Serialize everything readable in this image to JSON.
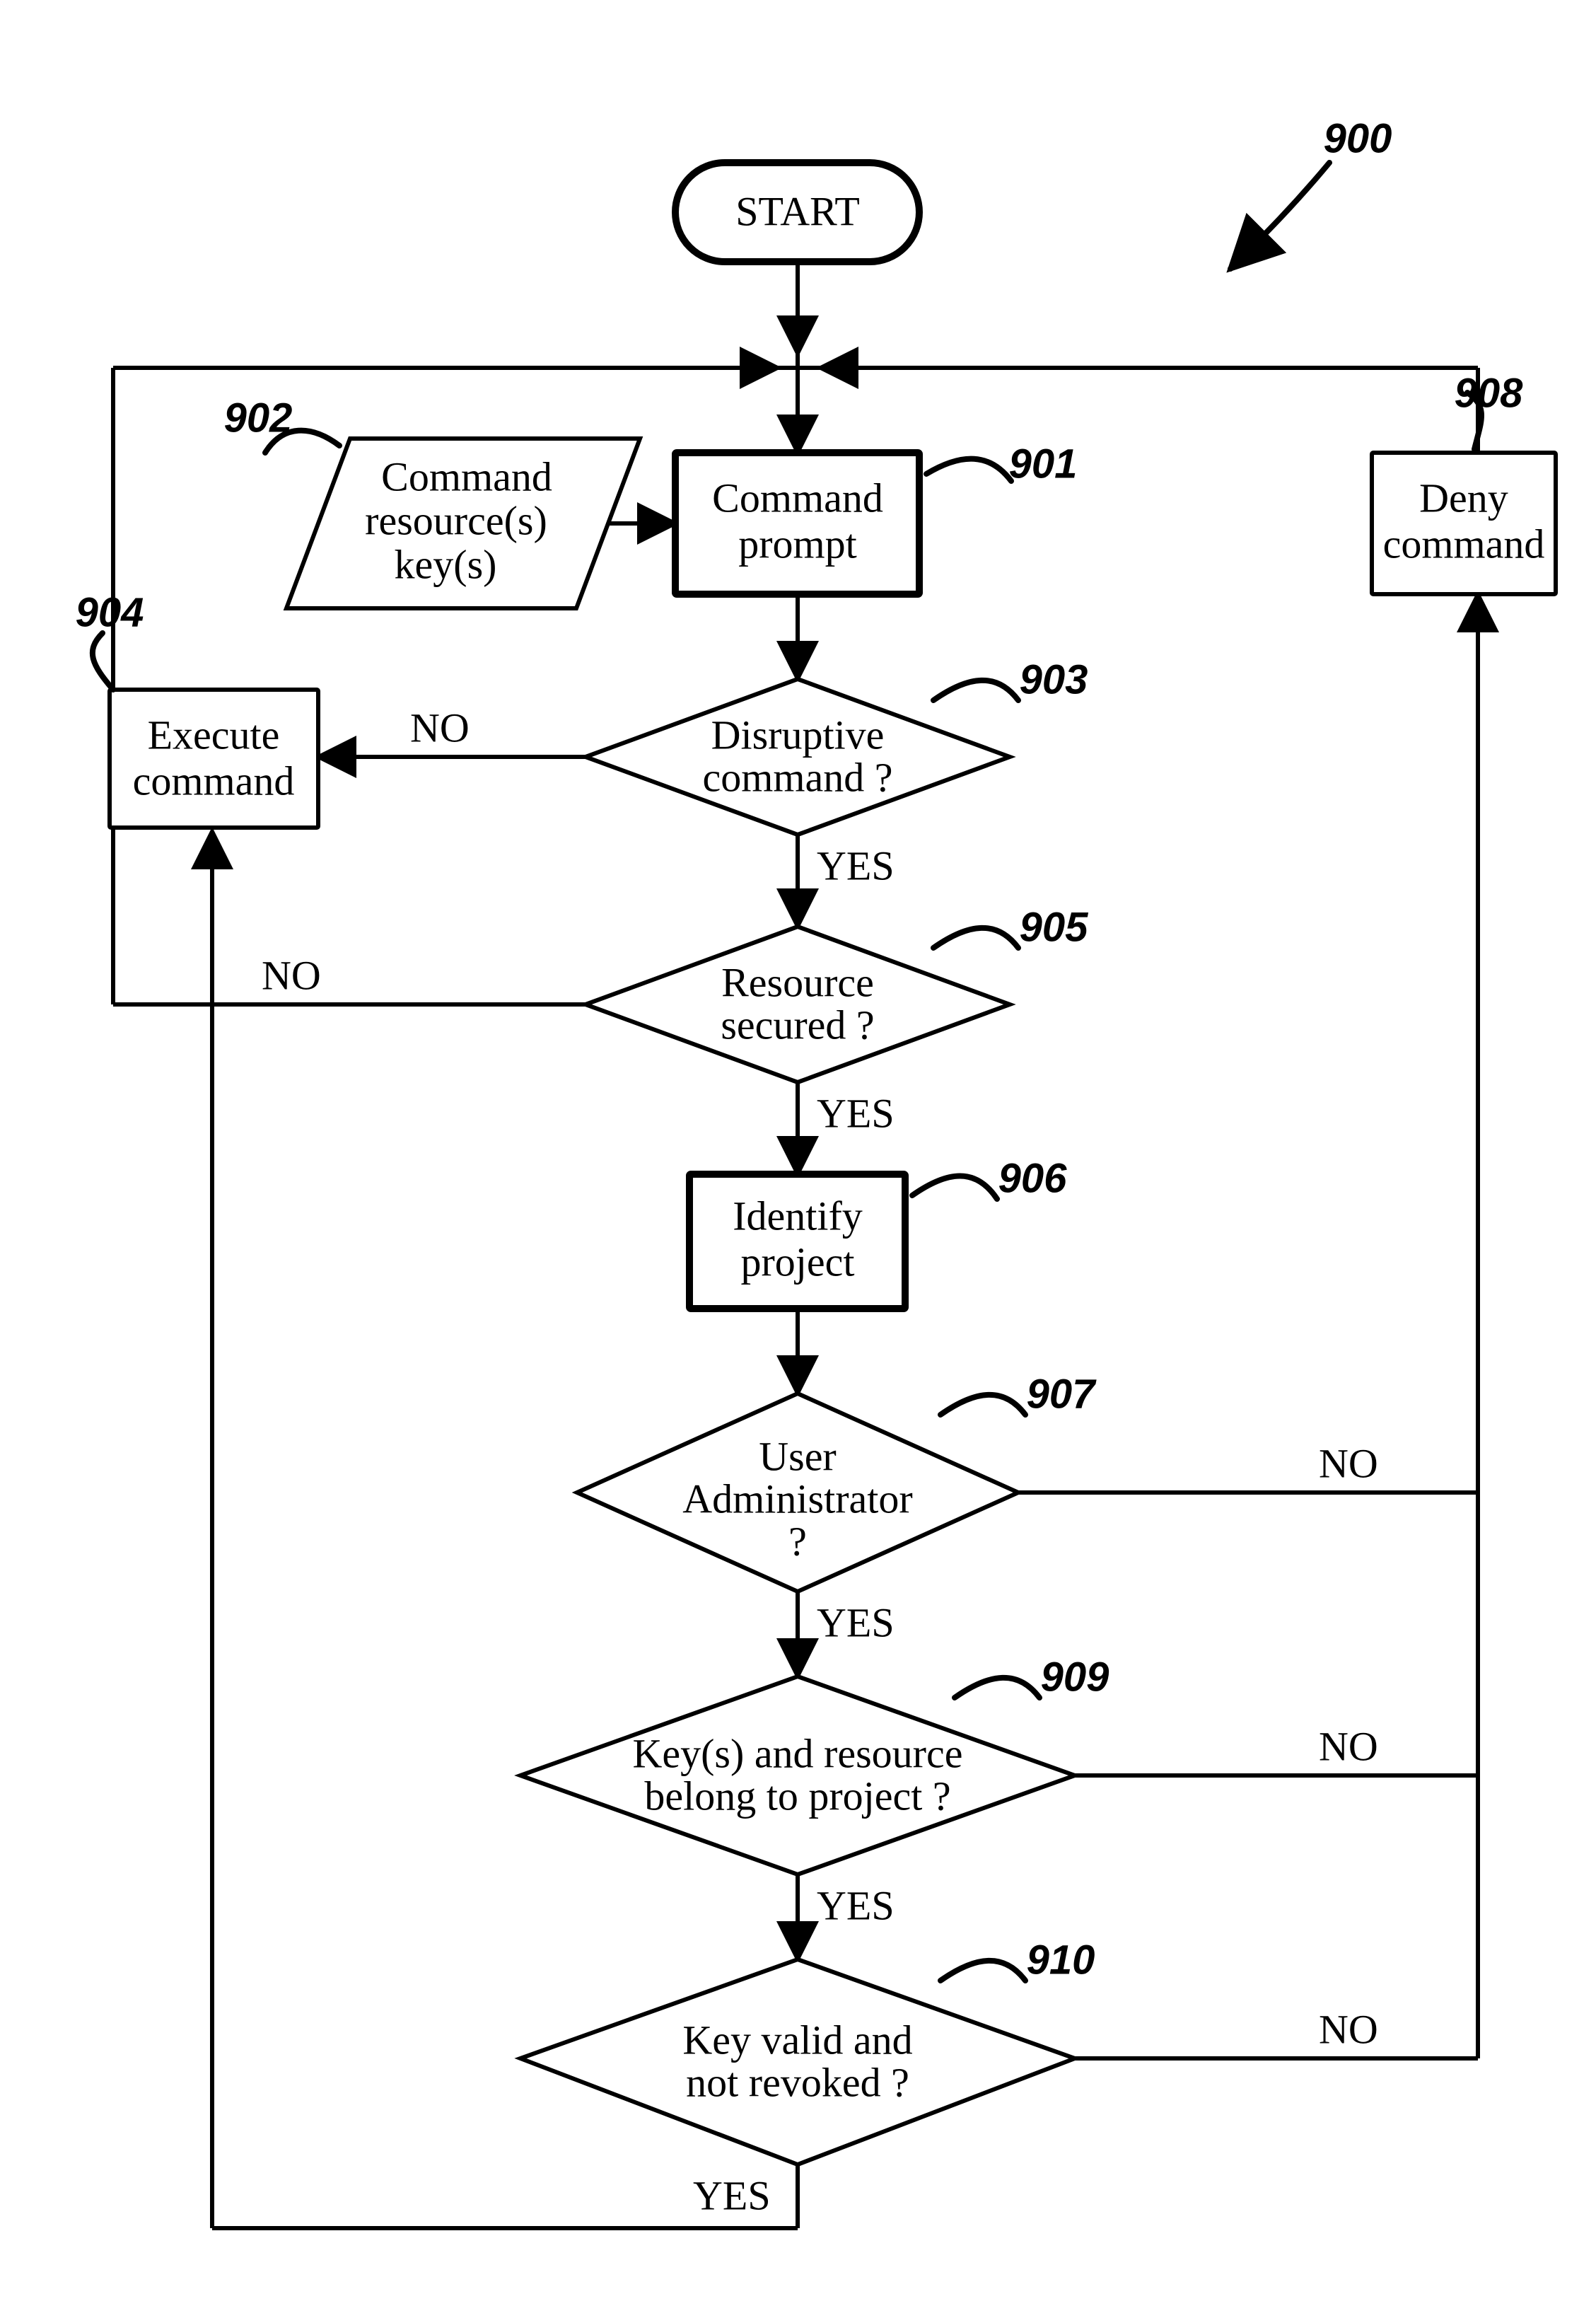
{
  "diagram_ref": "900",
  "nodes": {
    "start": {
      "text": "START"
    },
    "n901": {
      "ref": "901",
      "lines": [
        "Command",
        "prompt"
      ]
    },
    "n902": {
      "ref": "902",
      "lines": [
        "Command",
        "resource(s)",
        "key(s)"
      ]
    },
    "n903": {
      "ref": "903",
      "lines": [
        "Disruptive",
        "command ?"
      ]
    },
    "n904": {
      "ref": "904",
      "lines": [
        "Execute",
        "command"
      ]
    },
    "n905": {
      "ref": "905",
      "lines": [
        "Resource",
        "secured ?"
      ]
    },
    "n906": {
      "ref": "906",
      "lines": [
        "Identify",
        "project"
      ]
    },
    "n907": {
      "ref": "907",
      "lines": [
        "User",
        "Administrator",
        "?"
      ]
    },
    "n908": {
      "ref": "908",
      "lines": [
        "Deny",
        "command"
      ]
    },
    "n909": {
      "ref": "909",
      "lines": [
        "Key(s) and resource",
        "belong to project ?"
      ]
    },
    "n910": {
      "ref": "910",
      "lines": [
        "Key valid and",
        "not revoked ?"
      ]
    }
  },
  "edge_labels": {
    "yes": "YES",
    "no": "NO"
  }
}
